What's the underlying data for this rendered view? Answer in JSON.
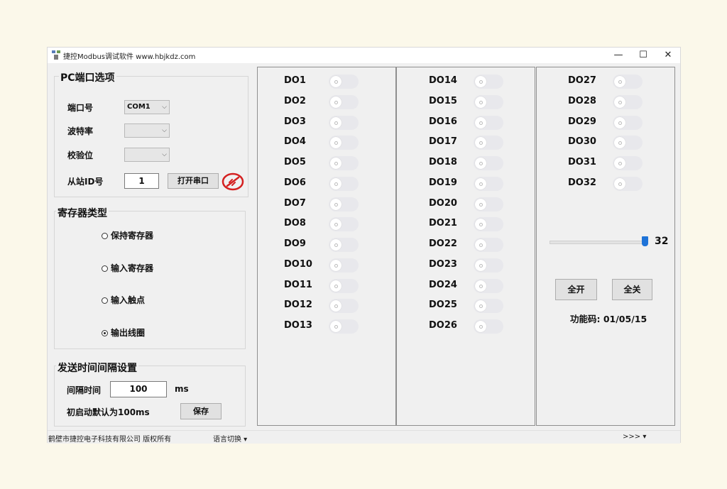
{
  "window": {
    "title": "捷控Modbus调试软件 www.hbjkdz.com",
    "minimize": "—",
    "maximize": "☐",
    "close": "✕"
  },
  "pc_port": {
    "title": "PC端口选项",
    "port_label": "端口号",
    "port_value": "COM1",
    "baud_label": "波特率",
    "baud_value": "",
    "parity_label": "校验位",
    "parity_value": "",
    "slave_label": "从站ID号",
    "slave_value": "1",
    "open_button": "打开串口"
  },
  "register_type": {
    "title": "寄存器类型",
    "options": [
      {
        "label": "保持寄存器",
        "selected": false
      },
      {
        "label": "输入寄存器",
        "selected": false
      },
      {
        "label": "输入触点",
        "selected": false
      },
      {
        "label": "输出线圈",
        "selected": true
      }
    ]
  },
  "interval": {
    "title": "发送时间间隔设置",
    "interval_label": "间隔时间",
    "interval_value": "100",
    "unit": "ms",
    "default_note": "初启动默认为100ms",
    "save_button": "保存"
  },
  "do_columns": [
    [
      "DO1",
      "DO2",
      "DO3",
      "DO4",
      "DO5",
      "DO6",
      "DO7",
      "DO8",
      "DO9",
      "DO10",
      "DO11",
      "DO12",
      "DO13"
    ],
    [
      "DO14",
      "DO15",
      "DO16",
      "DO17",
      "DO18",
      "DO19",
      "DO20",
      "DO21",
      "DO22",
      "DO23",
      "DO24",
      "DO25",
      "DO26"
    ],
    [
      "DO27",
      "DO28",
      "DO29",
      "DO30",
      "DO31",
      "DO32"
    ]
  ],
  "controls": {
    "slider_value": "32",
    "all_on": "全开",
    "all_off": "全关",
    "function_code": "功能码: 01/05/15"
  },
  "status_bar": {
    "company": "鹤壁市捷控电子科技有限公司   版权所有",
    "language": "语言切换  ▾",
    "more": ">>>  ▾"
  },
  "colors": {
    "accent": "#1e73d8",
    "disconnected_icon": "#d42020"
  }
}
